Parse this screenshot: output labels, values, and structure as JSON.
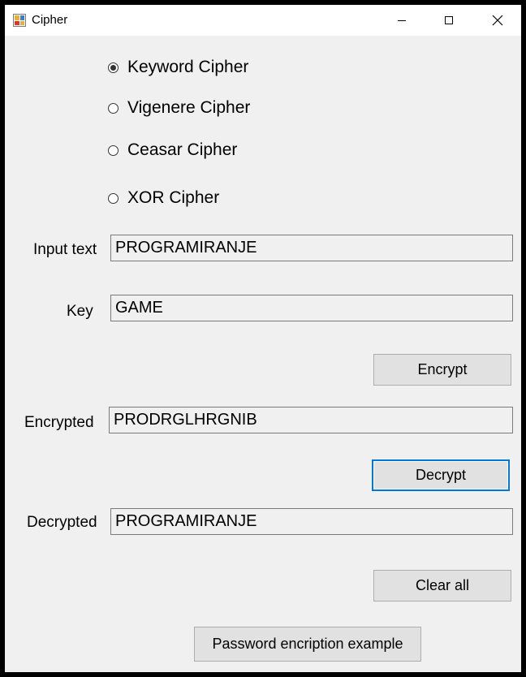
{
  "window": {
    "title": "Cipher",
    "icon": "app-icon",
    "controls": [
      "minimize-icon",
      "maximize-icon",
      "close-icon"
    ]
  },
  "cipher_options": [
    {
      "label": "Keyword Cipher",
      "checked": true
    },
    {
      "label": "Vigenere Cipher",
      "checked": false
    },
    {
      "label": "Ceasar Cipher",
      "checked": false
    },
    {
      "label": "XOR Cipher",
      "checked": false
    }
  ],
  "fields": {
    "input_text": {
      "label": "Input text",
      "value": "PROGRAMIRANJE"
    },
    "key": {
      "label": "Key",
      "value": "GAME"
    },
    "encrypted": {
      "label": "Encrypted",
      "value": "PRODRGLHRGNIB"
    },
    "decrypted": {
      "label": "Decrypted",
      "value": "PROGRAMIRANJE"
    }
  },
  "buttons": {
    "encrypt": "Encrypt",
    "decrypt": "Decrypt",
    "clear_all": "Clear all",
    "password_example": "Password encription example"
  },
  "colors": {
    "window_bg": "#f0f0f0",
    "titlebar_bg": "#ffffff",
    "focus_border": "#0078d7"
  }
}
